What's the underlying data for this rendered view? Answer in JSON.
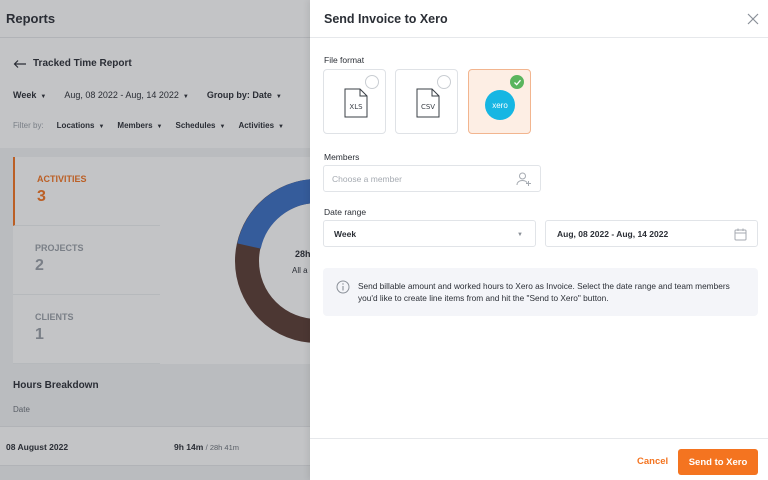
{
  "background": {
    "title": "Reports",
    "report_title": "Tracked Time Report",
    "period": "Week",
    "date_range": "Aug, 08 2022 - Aug, 14 2022",
    "group_by": "Group by: Date",
    "filter_label": "Filter by:",
    "filters": [
      "Locations",
      "Members",
      "Schedules",
      "Activities"
    ],
    "stats": [
      {
        "label": "ACTIVITIES",
        "value": "3"
      },
      {
        "label": "PROJECTS",
        "value": "2"
      },
      {
        "label": "CLIENTS",
        "value": "1"
      }
    ],
    "donut_value": "28h",
    "donut_sub": "All a",
    "donut_colors": [
      "#3b6fc4",
      "#5a3c34"
    ],
    "breakdown_title": "Hours Breakdown",
    "breakdown_col": "Date",
    "breakdown_row": {
      "date": "08 August 2022",
      "time": "9h 14m",
      "total": "/ 28h 41m"
    }
  },
  "modal": {
    "title": "Send Invoice to Xero",
    "file_format_label": "File format",
    "formats": [
      {
        "label": "XLS",
        "selected": false
      },
      {
        "label": "CSV",
        "selected": false
      },
      {
        "label": "xero",
        "selected": true
      }
    ],
    "members_label": "Members",
    "members_placeholder": "Choose a member",
    "date_range_label": "Date range",
    "range_type": "Week",
    "range_value": "Aug, 08 2022 - Aug, 14 2022",
    "info_text": "Send billable amount and worked hours to Xero as Invoice. Select the date range and team members you'd like to create line items from and hit the \"Send to Xero\" button.",
    "cancel_label": "Cancel",
    "send_label": "Send to Xero"
  },
  "colors": {
    "accent": "#f47420",
    "xero": "#16b6e3",
    "check": "#5ab55e"
  }
}
